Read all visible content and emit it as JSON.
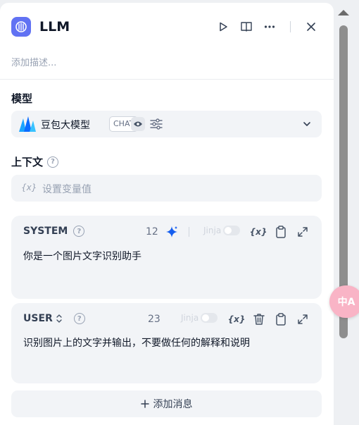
{
  "header": {
    "title": "LLM",
    "icons": [
      "llm-node-icon",
      "play-icon",
      "book-icon",
      "more-icon",
      "close-icon"
    ]
  },
  "description_placeholder": "添加描述...",
  "model_section": {
    "label": "模型",
    "model_name": "豆包大模型",
    "badge": "CHAT"
  },
  "context_section": {
    "label": "上下文",
    "var_symbol": "{x}",
    "placeholder": "设置变量值"
  },
  "messages": [
    {
      "role": "SYSTEM",
      "count": "12",
      "jinja_label": "Jinja",
      "var_symbol": "{x}",
      "text": "你是一个图片文字识别助手"
    },
    {
      "role": "USER",
      "count": "23",
      "jinja_label": "Jinja",
      "var_symbol": "{x}",
      "text": "识别图片上的文字并输出，不要做任何的解释和说明"
    }
  ],
  "add_message_label": "添加消息",
  "translate_button_label": "中A",
  "colors": {
    "accent": "#6172f3",
    "sparkle": "#155eef",
    "panel_bg": "#ffffff",
    "field_bg": "#f2f4f7"
  }
}
